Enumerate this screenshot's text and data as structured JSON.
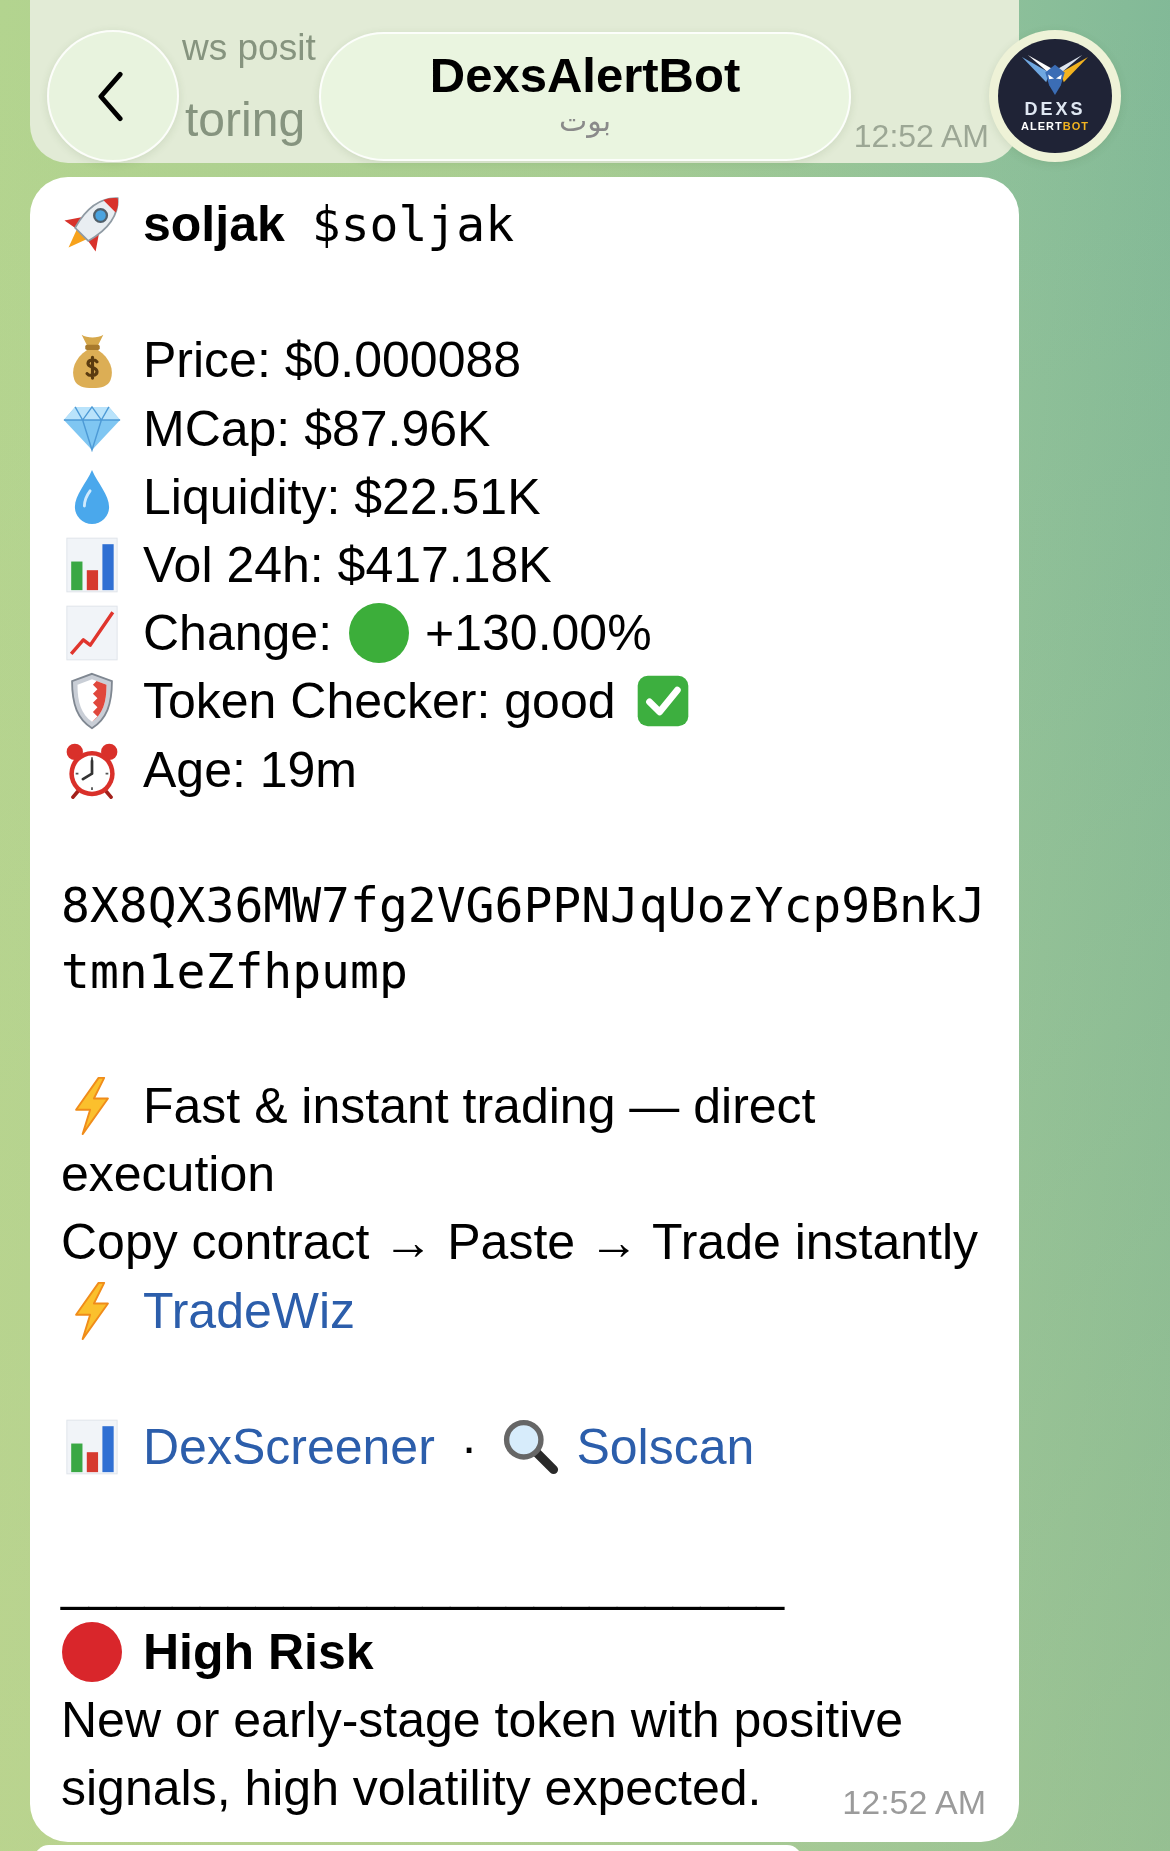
{
  "header": {
    "title": "DexsAlertBot",
    "subtitle": "بوت",
    "avatar": {
      "wordmark": "DEXS",
      "tagline": [
        {
          "text": "ALERT",
          "color": "#ffffff"
        },
        {
          "text": "BOT",
          "color": "#f2b320"
        }
      ]
    }
  },
  "previous_message": {
    "lines": [
      "ws posit",
      "toring"
    ],
    "time": "12:52 AM"
  },
  "message": {
    "token": {
      "name": "soljak",
      "ticker": "$soljak"
    },
    "stats": [
      {
        "kind": "price",
        "text": "Price: $0.000088"
      },
      {
        "kind": "market_cap",
        "text": "MCap: $87.96K"
      },
      {
        "kind": "liquidity",
        "text": "Liquidity: $22.51K"
      },
      {
        "kind": "volume",
        "text": "Vol 24h: $417.18K"
      },
      {
        "kind": "change",
        "text": "Change:",
        "color": "#3cae3a",
        "value": "+130.00%"
      },
      {
        "kind": "checker",
        "text": "Token Checker: good",
        "passed": true
      },
      {
        "kind": "age",
        "text": "Age: 19m"
      }
    ],
    "contract_address": "8X8QX36MW7fg2VG6PPNJqUozYcp9BnkJtmn1eZfhpump",
    "promo": {
      "headline_lines": [
        "Fast & instant trading — direct",
        "execution"
      ],
      "steps": "Copy contract → Paste → Trade instantly",
      "link": "TradeWiz"
    },
    "links": [
      {
        "kind": "chart",
        "label": "DexScreener"
      },
      {
        "kind": "explorer",
        "label": "Solscan"
      }
    ],
    "link_separator": "·",
    "divider": "__________________________",
    "risk": {
      "title": "High Risk",
      "color": "#d9262b",
      "description_lines": [
        "New or early-stage token with positive",
        "signals, high volatility expected."
      ]
    },
    "time": "12:52 AM"
  }
}
